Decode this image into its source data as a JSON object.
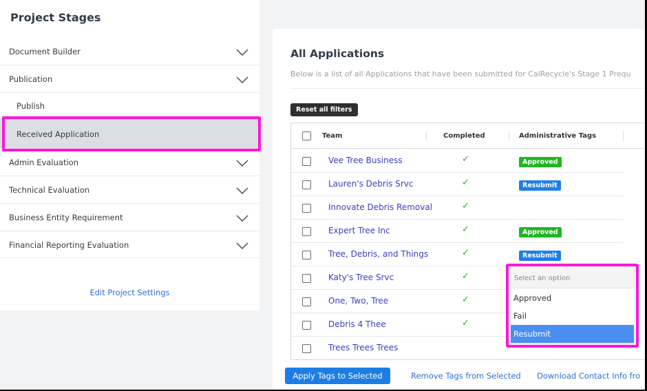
{
  "sidebar": {
    "title": "Project Stages",
    "items": [
      {
        "label": "Document Builder",
        "chevron": true
      },
      {
        "label": "Publication",
        "chevron": true
      },
      {
        "label": "Publish",
        "chevron": false,
        "sub": true
      },
      {
        "label": "Received Application",
        "chevron": false,
        "sub": true,
        "selected": true
      },
      {
        "label": "Admin Evaluation",
        "chevron": true
      },
      {
        "label": "Technical Evaluation",
        "chevron": true
      },
      {
        "label": "Business Entity Requirement",
        "chevron": true
      },
      {
        "label": "Financial Reporting Evaluation",
        "chevron": true
      }
    ],
    "edit_link": "Edit Project Settings"
  },
  "main": {
    "title": "All Applications",
    "description": "Below is a list of all Applications that have been submitted for CalRecycle's Stage 1 Prequ",
    "reset_label": "Reset all filters",
    "table": {
      "columns": [
        "Team",
        "Completed",
        "Administrative Tags"
      ],
      "rows": [
        {
          "team": "Vee Tree Business",
          "completed": "✓",
          "tag": "Approved"
        },
        {
          "team": "Lauren's Debris Srvc",
          "completed": "✓",
          "tag": "Resubmit"
        },
        {
          "team": "Innovate Debris Removal",
          "completed": "✓",
          "tag": ""
        },
        {
          "team": "Expert Tree Inc",
          "completed": "✓",
          "tag": "Approved"
        },
        {
          "team": "Tree, Debris, and Things",
          "completed": "✓",
          "tag": "Resubmit"
        },
        {
          "team": "Katy's Tree Srvc",
          "completed": "✓",
          "tag": ""
        },
        {
          "team": "One, Two, Tree",
          "completed": "✓",
          "tag": ""
        },
        {
          "team": "Debris 4 Thee",
          "completed": "✓",
          "tag": ""
        },
        {
          "team": "Trees Trees Trees",
          "completed": "",
          "tag": ""
        }
      ]
    }
  },
  "dropdown": {
    "placeholder": "Select an option",
    "options": [
      "Approved",
      "Fail",
      "Resubmit"
    ],
    "highlighted": "Resubmit"
  },
  "actions": {
    "apply_label": "Apply Tags to Selected",
    "remove_label": "Remove Tags from Selected",
    "download_label": "Download Contact Info fro"
  },
  "colors": {
    "highlight": "#ff16d8",
    "approved": "#21b521",
    "resubmit": "#1f7ee6",
    "link": "#2c6fd6"
  }
}
